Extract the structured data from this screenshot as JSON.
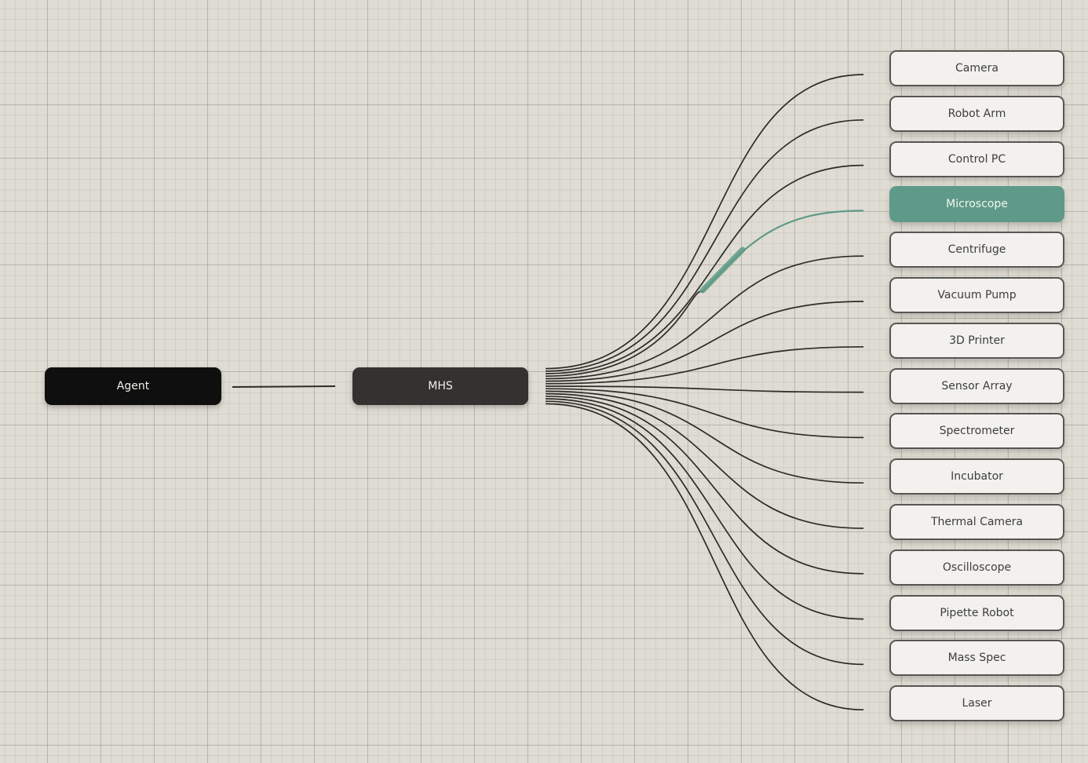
{
  "diagram": {
    "source": {
      "label": "Agent"
    },
    "hub": {
      "label": "MHS"
    },
    "devices": [
      {
        "label": "Camera",
        "active": false
      },
      {
        "label": "Robot Arm",
        "active": false
      },
      {
        "label": "Control PC",
        "active": false
      },
      {
        "label": "Microscope",
        "active": true
      },
      {
        "label": "Centrifuge",
        "active": false
      },
      {
        "label": "Vacuum Pump",
        "active": false
      },
      {
        "label": "3D Printer",
        "active": false
      },
      {
        "label": "Sensor Array",
        "active": false
      },
      {
        "label": "Spectrometer",
        "active": false
      },
      {
        "label": "Incubator",
        "active": false
      },
      {
        "label": "Thermal Camera",
        "active": false
      },
      {
        "label": "Oscilloscope",
        "active": false
      },
      {
        "label": "Pipette Robot",
        "active": false
      },
      {
        "label": "Mass Spec",
        "active": false
      },
      {
        "label": "Laser",
        "active": false
      }
    ]
  },
  "colors": {
    "background": "#dfdcd3",
    "agent": "#0f0f0f",
    "hub": "#333231",
    "connector": "#2b2b29",
    "active_accent": "#5f9a88",
    "device_fill": "#f2f1ed"
  }
}
